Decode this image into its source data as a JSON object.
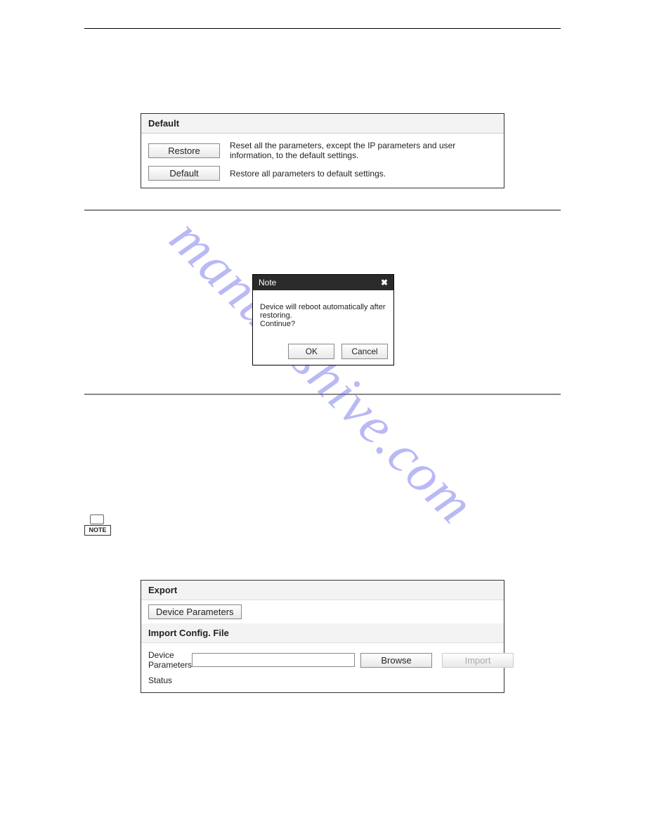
{
  "watermark": "manualshive.com",
  "default_panel": {
    "title": "Default",
    "rows": [
      {
        "button": "Restore",
        "text": "Reset all the parameters, except the IP parameters and user information, to the default settings."
      },
      {
        "button": "Default",
        "text": "Restore all parameters to default settings."
      }
    ]
  },
  "dialog": {
    "title": "Note",
    "body_line1": "Device will reboot automatically after restoring.",
    "body_line2": "Continue?",
    "ok": "OK",
    "cancel": "Cancel"
  },
  "note_icon_label": "NOTE",
  "export_panel": {
    "export_title": "Export",
    "device_params_btn": "Device Parameters",
    "import_title": "Import Config. File",
    "device_params_label": "Device Parameters",
    "browse": "Browse",
    "import": "Import",
    "status_label": "Status"
  }
}
